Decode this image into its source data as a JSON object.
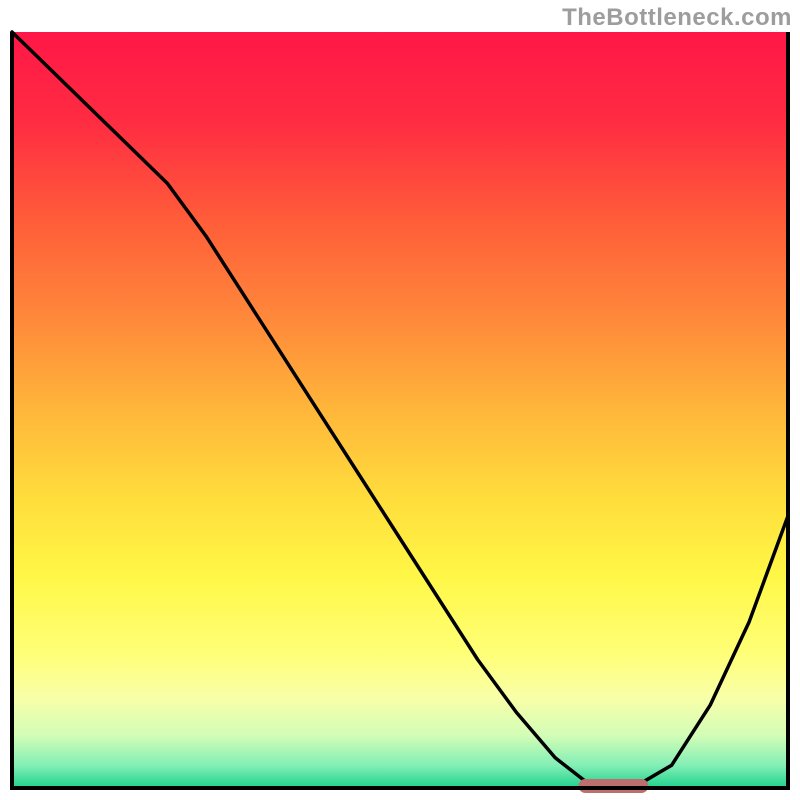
{
  "watermark": "TheBottleneck.com",
  "colors": {
    "curve_stroke": "#000000",
    "indicator_fill": "#bc6f6e",
    "frame_stroke": "#000000",
    "gradient_stops": [
      {
        "offset": 0.0,
        "color": "#ff1747"
      },
      {
        "offset": 0.12,
        "color": "#ff2c42"
      },
      {
        "offset": 0.25,
        "color": "#ff5d39"
      },
      {
        "offset": 0.38,
        "color": "#ff893a"
      },
      {
        "offset": 0.5,
        "color": "#ffb63a"
      },
      {
        "offset": 0.62,
        "color": "#ffde3c"
      },
      {
        "offset": 0.72,
        "color": "#fff747"
      },
      {
        "offset": 0.82,
        "color": "#ffff76"
      },
      {
        "offset": 0.88,
        "color": "#f8ffa7"
      },
      {
        "offset": 0.93,
        "color": "#d3fdb7"
      },
      {
        "offset": 0.97,
        "color": "#83efb5"
      },
      {
        "offset": 1.0,
        "color": "#1fd18d"
      }
    ]
  },
  "chart_data": {
    "type": "line",
    "title": "",
    "xlabel": "",
    "ylabel": "",
    "x": [
      0.0,
      0.05,
      0.1,
      0.15,
      0.2,
      0.25,
      0.3,
      0.35,
      0.4,
      0.45,
      0.5,
      0.55,
      0.6,
      0.65,
      0.7,
      0.75,
      0.8,
      0.85,
      0.9,
      0.95,
      1.0
    ],
    "values": [
      1.0,
      0.95,
      0.9,
      0.85,
      0.8,
      0.73,
      0.65,
      0.57,
      0.49,
      0.41,
      0.33,
      0.25,
      0.17,
      0.1,
      0.04,
      0.0,
      0.0,
      0.03,
      0.11,
      0.22,
      0.36
    ],
    "xlim": [
      0,
      1
    ],
    "ylim": [
      0,
      1
    ],
    "indicator": {
      "x_start": 0.73,
      "x_end": 0.82,
      "y": 0.0
    }
  }
}
